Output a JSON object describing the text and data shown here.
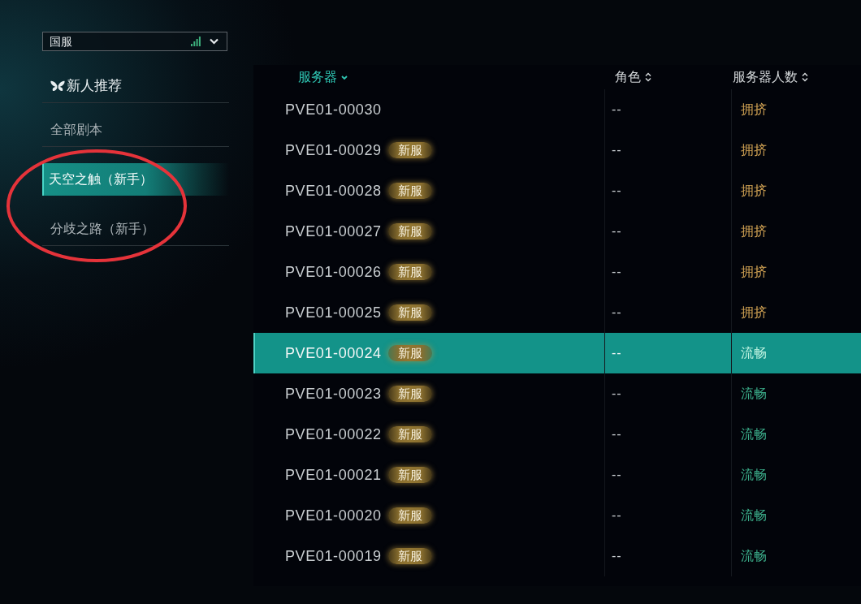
{
  "region_select": {
    "value": "国服"
  },
  "sidebar": {
    "header": "新人推荐",
    "items": [
      {
        "label": "全部剧本",
        "selected": false
      },
      {
        "label": "天空之触（新手）",
        "selected": true
      },
      {
        "label": "分歧之路（新手）",
        "selected": false
      }
    ]
  },
  "table": {
    "columns": [
      {
        "label": "服务器",
        "sorted": true
      },
      {
        "label": "角色",
        "sorted": false
      },
      {
        "label": "服务器人数",
        "sorted": false
      }
    ],
    "rows": [
      {
        "server": "PVE01-00030",
        "role": "--",
        "status": {
          "text": "拥挤",
          "kind": "crowded"
        },
        "selected": false
      },
      {
        "server": "PVE01-00029",
        "badge": "新服",
        "role": "--",
        "status": {
          "text": "拥挤",
          "kind": "crowded"
        },
        "selected": false
      },
      {
        "server": "PVE01-00028",
        "badge": "新服",
        "role": "--",
        "status": {
          "text": "拥挤",
          "kind": "crowded"
        },
        "selected": false
      },
      {
        "server": "PVE01-00027",
        "badge": "新服",
        "role": "--",
        "status": {
          "text": "拥挤",
          "kind": "crowded"
        },
        "selected": false
      },
      {
        "server": "PVE01-00026",
        "badge": "新服",
        "role": "--",
        "status": {
          "text": "拥挤",
          "kind": "crowded"
        },
        "selected": false
      },
      {
        "server": "PVE01-00025",
        "badge": "新服",
        "role": "--",
        "status": {
          "text": "拥挤",
          "kind": "crowded"
        },
        "selected": false
      },
      {
        "server": "PVE01-00024",
        "badge": "新服",
        "role": "--",
        "status": {
          "text": "流畅",
          "kind": "smooth"
        },
        "selected": true
      },
      {
        "server": "PVE01-00023",
        "badge": "新服",
        "role": "--",
        "status": {
          "text": "流畅",
          "kind": "smooth"
        },
        "selected": false
      },
      {
        "server": "PVE01-00022",
        "badge": "新服",
        "role": "--",
        "status": {
          "text": "流畅",
          "kind": "smooth"
        },
        "selected": false
      },
      {
        "server": "PVE01-00021",
        "badge": "新服",
        "role": "--",
        "status": {
          "text": "流畅",
          "kind": "smooth"
        },
        "selected": false
      },
      {
        "server": "PVE01-00020",
        "badge": "新服",
        "role": "--",
        "status": {
          "text": "流畅",
          "kind": "smooth"
        },
        "selected": false
      },
      {
        "server": "PVE01-00019",
        "badge": "新服",
        "role": "--",
        "status": {
          "text": "流畅",
          "kind": "smooth"
        },
        "selected": false
      }
    ]
  },
  "annotation": {
    "kind": "ellipse"
  }
}
